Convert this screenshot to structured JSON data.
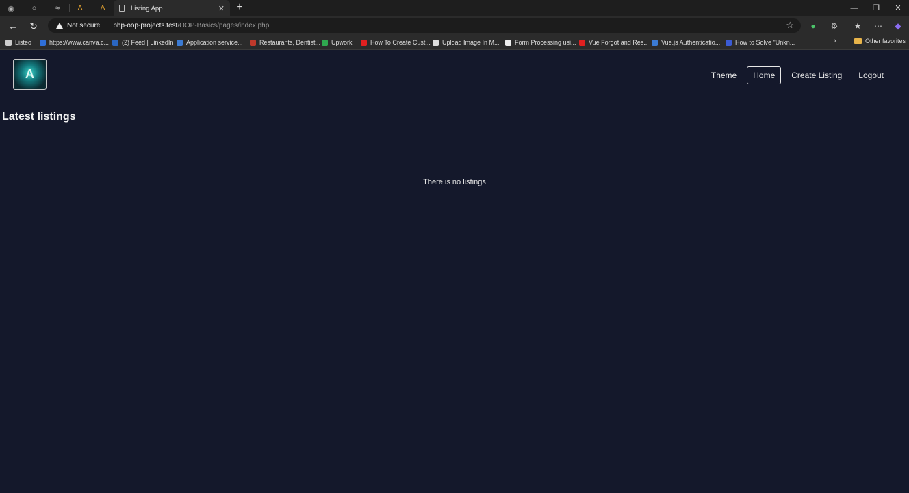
{
  "browser": {
    "active_tab_title": "Listing App",
    "not_secure_label": "Not secure",
    "url_host": "php-oop-projects.test",
    "url_path": "/OOP-Basics/pages/index.php",
    "bookmarks": [
      {
        "label": "Listeo",
        "color": "#cccccc"
      },
      {
        "label": "https://www.canva.c...",
        "color": "#2f6fd8"
      },
      {
        "label": "(2) Feed | LinkedIn",
        "color": "#2a66c2"
      },
      {
        "label": "Application service...",
        "color": "#3b7bd4"
      },
      {
        "label": "Restaurants, Dentist...",
        "color": "#c0392b"
      },
      {
        "label": "Upwork",
        "color": "#2fa84f"
      },
      {
        "label": "How To Create Cust...",
        "color": "#e02020"
      },
      {
        "label": "Upload Image In M...",
        "color": "#dddddd"
      },
      {
        "label": "Form Processing usi...",
        "color": "#eeeeee"
      },
      {
        "label": "Vue Forgot and Res...",
        "color": "#e02020"
      },
      {
        "label": "Vue.js Authenticatio...",
        "color": "#3b7bd4"
      },
      {
        "label": "How to Solve \"Unkn...",
        "color": "#3b5bd4"
      }
    ],
    "other_favorites": "Other favorites"
  },
  "nav": {
    "links": [
      "Theme",
      "Home",
      "Create Listing",
      "Logout"
    ],
    "active": "Home"
  },
  "main": {
    "heading": "Latest listings",
    "empty_message": "There is no listings"
  }
}
